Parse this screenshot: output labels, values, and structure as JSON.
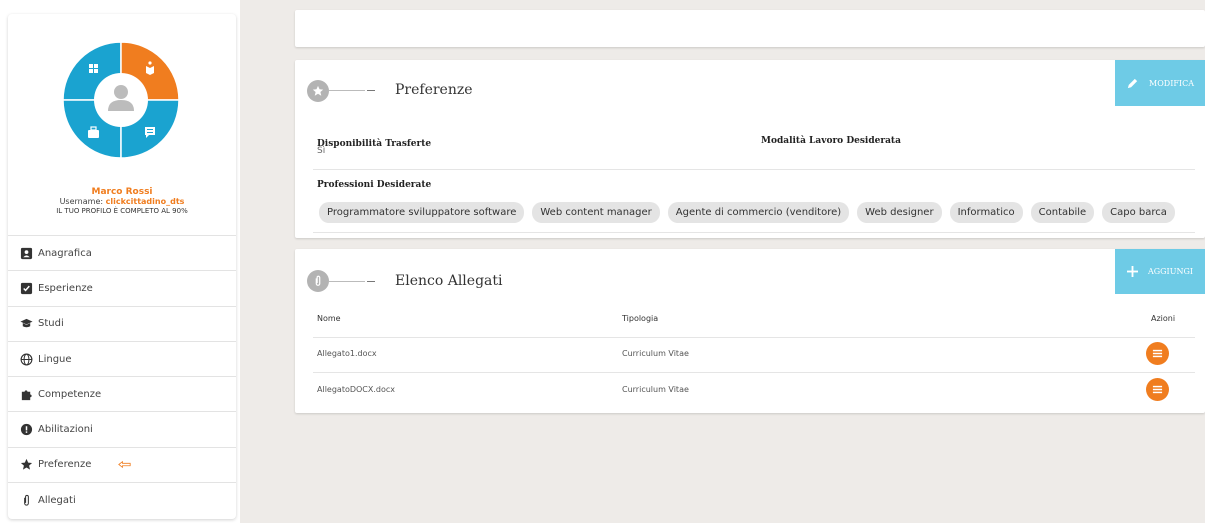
{
  "profile": {
    "name": "Marco Rossi",
    "username_label": "Username: ",
    "username": "clickcittadino_dts",
    "completion": "IL TUO PROFILO È COMPLETO AL 90%",
    "active_color": "#f07d1f",
    "donut_color": "#1aa3d0"
  },
  "menu": {
    "items": [
      {
        "label": "Anagrafica",
        "icon": "id-card-icon"
      },
      {
        "label": "Esperienze",
        "icon": "briefcase-check-icon"
      },
      {
        "label": "Studi",
        "icon": "graduation-cap-icon"
      },
      {
        "label": "Lingue",
        "icon": "globe-icon"
      },
      {
        "label": "Competenze",
        "icon": "puzzle-icon"
      },
      {
        "label": "Abilitazioni",
        "icon": "certificate-icon"
      },
      {
        "label": "Preferenze",
        "icon": "star-icon"
      },
      {
        "label": "Allegati",
        "icon": "paperclip-icon"
      }
    ]
  },
  "preferences": {
    "title": "Preferenze",
    "edit_label": "MODIFICA",
    "travel_label": "Disponibilità Trasferte",
    "travel_value": "Sì",
    "work_mode_label": "Modalità Lavoro Desiderata",
    "professions_label": "Professioni Desiderate",
    "professions": [
      "Programmatore sviluppatore software",
      "Web content manager",
      "Agente di commercio (venditore)",
      "Web designer",
      "Informatico",
      "Contabile",
      "Capo barca"
    ]
  },
  "attachments": {
    "title": "Elenco Allegati",
    "add_label": "AGGIUNGI",
    "columns": {
      "name": "Nome",
      "type": "Tipologia",
      "actions": "Azioni"
    },
    "rows": [
      {
        "name": "Allegato1.docx",
        "type": "Curriculum Vitae"
      },
      {
        "name": "AllegatoDOCX.docx",
        "type": "Curriculum Vitae"
      }
    ]
  },
  "colors": {
    "accent_orange": "#f07d1f",
    "accent_blue": "#6ecbe6",
    "background": "#eeebe8"
  }
}
